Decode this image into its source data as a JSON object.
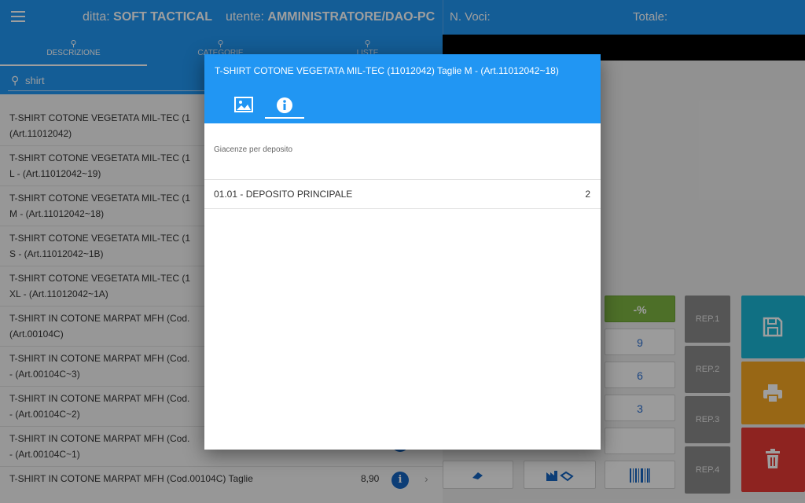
{
  "header": {
    "ditta_label": "ditta:",
    "ditta_value": "SOFT TACTICAL",
    "utente_label": "utente:",
    "utente_value": "AMMINISTRATORE/DAO-PC"
  },
  "tabs": [
    {
      "label": "DESCRIZIONE",
      "icon": "search-icon"
    },
    {
      "label": "CATEGORIE",
      "icon": "search-icon"
    },
    {
      "label": "LISTE",
      "icon": "search-icon"
    }
  ],
  "search": {
    "value": "shirt",
    "icon": "search-icon"
  },
  "products": [
    {
      "line1": "T-SHIRT COTONE VEGETATA MIL-TEC (1",
      "line2": "(Art.11012042)"
    },
    {
      "line1": "T-SHIRT COTONE VEGETATA MIL-TEC (1",
      "line2": "L - (Art.11012042~19)"
    },
    {
      "line1": "T-SHIRT COTONE VEGETATA MIL-TEC (1",
      "line2": "M - (Art.11012042~18)"
    },
    {
      "line1": "T-SHIRT COTONE VEGETATA MIL-TEC (1",
      "line2": "S - (Art.11012042~1B)"
    },
    {
      "line1": "T-SHIRT COTONE VEGETATA MIL-TEC (1",
      "line2": "XL - (Art.11012042~1A)"
    },
    {
      "line1": "T-SHIRT IN COTONE MARPAT MFH (Cod.",
      "line2": "(Art.00104C)"
    },
    {
      "line1": "T-SHIRT IN COTONE MARPAT MFH (Cod.",
      "line2": "- (Art.00104C~3)"
    },
    {
      "line1": "T-SHIRT IN COTONE MARPAT MFH (Cod.",
      "line2": "- (Art.00104C~2)"
    },
    {
      "line1": "T-SHIRT IN COTONE MARPAT MFH (Cod.",
      "line2": "- (Art.00104C~1)"
    },
    {
      "line1": "T-SHIRT IN COTONE MARPAT MFH (Cod.00104C) Taglie",
      "line2": "",
      "price": "8,90"
    }
  ],
  "right_header": {
    "nvoci_label": "N. Voci:",
    "totale_label": "Totale:"
  },
  "keypad": {
    "discount": "-%",
    "k9": "9",
    "k6": "6",
    "k3": "3"
  },
  "reparti": [
    "REP.1",
    "REP.2",
    "REP.3",
    "REP.4"
  ],
  "actions": {
    "save_color": "#1ab5d4",
    "print_color": "#f5a623",
    "delete_color": "#e53935"
  },
  "dialog": {
    "title": "T-SHIRT COTONE VEGETATA MIL-TEC (11012042) Taglie M - (Art.11012042~18)",
    "section": "Giacenze per deposito",
    "deposito": "01.01 - DEPOSITO PRINCIPALE",
    "quantita": "2"
  },
  "colors": {
    "primary": "#2196f3",
    "green": "#7cb342",
    "rep": "#8a8a8a"
  }
}
